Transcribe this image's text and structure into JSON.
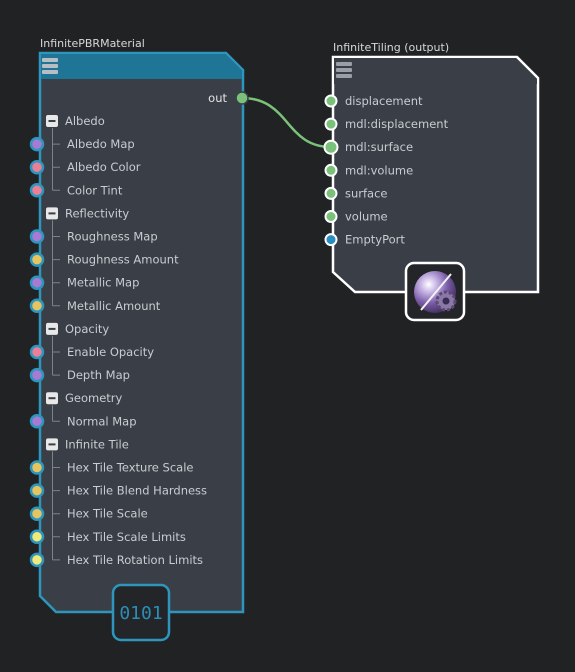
{
  "colors": {
    "background": "#202224",
    "node_body": "#3a3f47",
    "node_header_material": "#1f7595",
    "node_border_material": "#2e95bd",
    "node_header_output": "#3a3f47",
    "node_border_output": "#ffffff",
    "connection": "#7ac27a",
    "port_purple": "#a77bd3",
    "port_pink": "#ea7f97",
    "port_yellow": "#e6c560",
    "port_lightyellow": "#f0ea7a",
    "port_green": "#7ac27a",
    "port_blue": "#2a8fc0"
  },
  "material_node": {
    "title": "InfinitePBRMaterial",
    "header_icon": "hamburger-menu-icon",
    "output_label": "out",
    "badge_text": "0101",
    "groups": [
      {
        "label": "Albedo",
        "items": [
          {
            "label": "Albedo Map",
            "port": "purple"
          },
          {
            "label": "Albedo Color",
            "port": "pink"
          },
          {
            "label": "Color Tint",
            "port": "pink"
          }
        ]
      },
      {
        "label": "Reflectivity",
        "items": [
          {
            "label": "Roughness Map",
            "port": "purple"
          },
          {
            "label": "Roughness Amount",
            "port": "yellow"
          },
          {
            "label": "Metallic Map",
            "port": "purple"
          },
          {
            "label": "Metallic Amount",
            "port": "yellow"
          }
        ]
      },
      {
        "label": "Opacity",
        "items": [
          {
            "label": "Enable Opacity",
            "port": "pink"
          },
          {
            "label": "Depth Map",
            "port": "purple"
          }
        ]
      },
      {
        "label": "Geometry",
        "items": [
          {
            "label": "Normal Map",
            "port": "purple"
          }
        ]
      },
      {
        "label": "Infinite Tile",
        "items": [
          {
            "label": "Hex Tile Texture Scale",
            "port": "yellow"
          },
          {
            "label": "Hex Tile Blend Hardness",
            "port": "yellow"
          },
          {
            "label": "Hex Tile Scale",
            "port": "yellow"
          },
          {
            "label": "Hex Tile Scale Limits",
            "port": "lightyellow"
          },
          {
            "label": "Hex Tile Rotation Limits",
            "port": "lightyellow"
          }
        ]
      }
    ]
  },
  "output_node": {
    "title": "InfiniteTiling (output)",
    "header_icon": "hamburger-menu-icon",
    "badge_icon": "material-sphere-gear-icon",
    "inputs": [
      {
        "label": "displacement",
        "port": "green"
      },
      {
        "label": "mdl:displacement",
        "port": "green"
      },
      {
        "label": "mdl:surface",
        "port": "green",
        "connected": true
      },
      {
        "label": "mdl:volume",
        "port": "green"
      },
      {
        "label": "surface",
        "port": "green"
      },
      {
        "label": "volume",
        "port": "green"
      },
      {
        "label": "EmptyPort",
        "port": "blue"
      }
    ]
  }
}
